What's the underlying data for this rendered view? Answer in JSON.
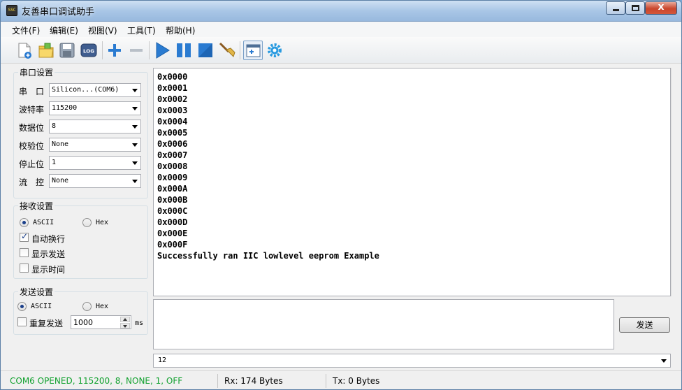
{
  "window": {
    "title": "友善串口调试助手",
    "app_icon_text": "SSC",
    "close_glyph": "x"
  },
  "menu": [
    "文件(F)",
    "编辑(E)",
    "视图(V)",
    "工具(T)",
    "帮助(H)"
  ],
  "toolbar_icons": [
    "new-file-icon",
    "open-folder-icon",
    "save-icon",
    "log-icon",
    "add-icon",
    "remove-icon",
    "play-icon",
    "pause-icon",
    "stop-icon",
    "broom-icon",
    "dock-window-icon",
    "settings-gear-icon"
  ],
  "toolbar": {
    "log_label": "LOG"
  },
  "serial_settings": {
    "title": "串口设置",
    "fields": [
      {
        "label": "串　口",
        "value": "Silicon...(COM6)"
      },
      {
        "label": "波特率",
        "value": "115200"
      },
      {
        "label": "数据位",
        "value": "8"
      },
      {
        "label": "校验位",
        "value": "None"
      },
      {
        "label": "停止位",
        "value": "1"
      },
      {
        "label": "流　控",
        "value": "None"
      }
    ]
  },
  "receive_settings": {
    "title": "接收设置",
    "mode_ascii": "ASCII",
    "mode_hex": "Hex",
    "selected_mode": "ASCII",
    "auto_newline": "自动换行",
    "auto_newline_checked": true,
    "show_send": "显示发送",
    "show_send_checked": false,
    "show_time": "显示时间",
    "show_time_checked": false
  },
  "send_settings": {
    "title": "发送设置",
    "mode_ascii": "ASCII",
    "mode_hex": "Hex",
    "selected_mode": "ASCII",
    "repeat_send": "重复发送",
    "repeat_checked": false,
    "interval_value": "1000",
    "interval_unit": "ms"
  },
  "receive_lines": [
    "0x0000",
    "0x0001",
    "0x0002",
    "0x0003",
    "0x0004",
    "0x0005",
    "0x0006",
    "0x0007",
    "0x0008",
    "0x0009",
    "0x000A",
    "0x000B",
    "0x000C",
    "0x000D",
    "0x000E",
    "0x000F",
    "Successfully ran IIC lowlevel eeprom Example"
  ],
  "send_button": "发送",
  "history_value": "12",
  "status": {
    "port": "COM6 OPENED, 115200, 8, NONE, 1, OFF",
    "rx": "Rx: 174 Bytes",
    "tx": "Tx: 0 Bytes"
  },
  "colors": {
    "status_ok": "#12a12f",
    "accent_blue": "#2a7bd1"
  }
}
